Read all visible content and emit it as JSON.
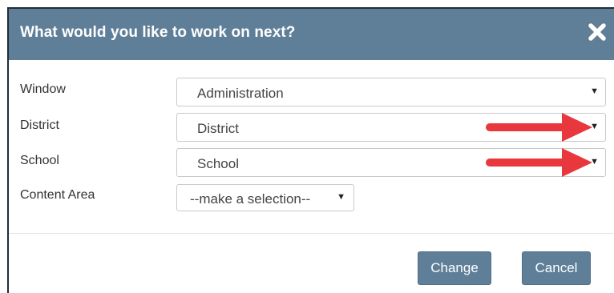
{
  "dialog": {
    "title": "What would you like to work on next?",
    "close_icon": "close-x-icon"
  },
  "fields": [
    {
      "label": "Window",
      "value": "Administration"
    },
    {
      "label": "District",
      "value": "District"
    },
    {
      "label": "School",
      "value": "School"
    },
    {
      "label": "Content Area",
      "value": "--make a selection--"
    }
  ],
  "caret_icon": "caret-down-icon",
  "annotation": {
    "arrow_color": "#e8383d",
    "arrow_targets": [
      "District",
      "School"
    ]
  },
  "buttons": {
    "change": "Change",
    "cancel": "Cancel"
  },
  "colors": {
    "titlebar": "#5f7f99",
    "button": "#5f7f99"
  }
}
